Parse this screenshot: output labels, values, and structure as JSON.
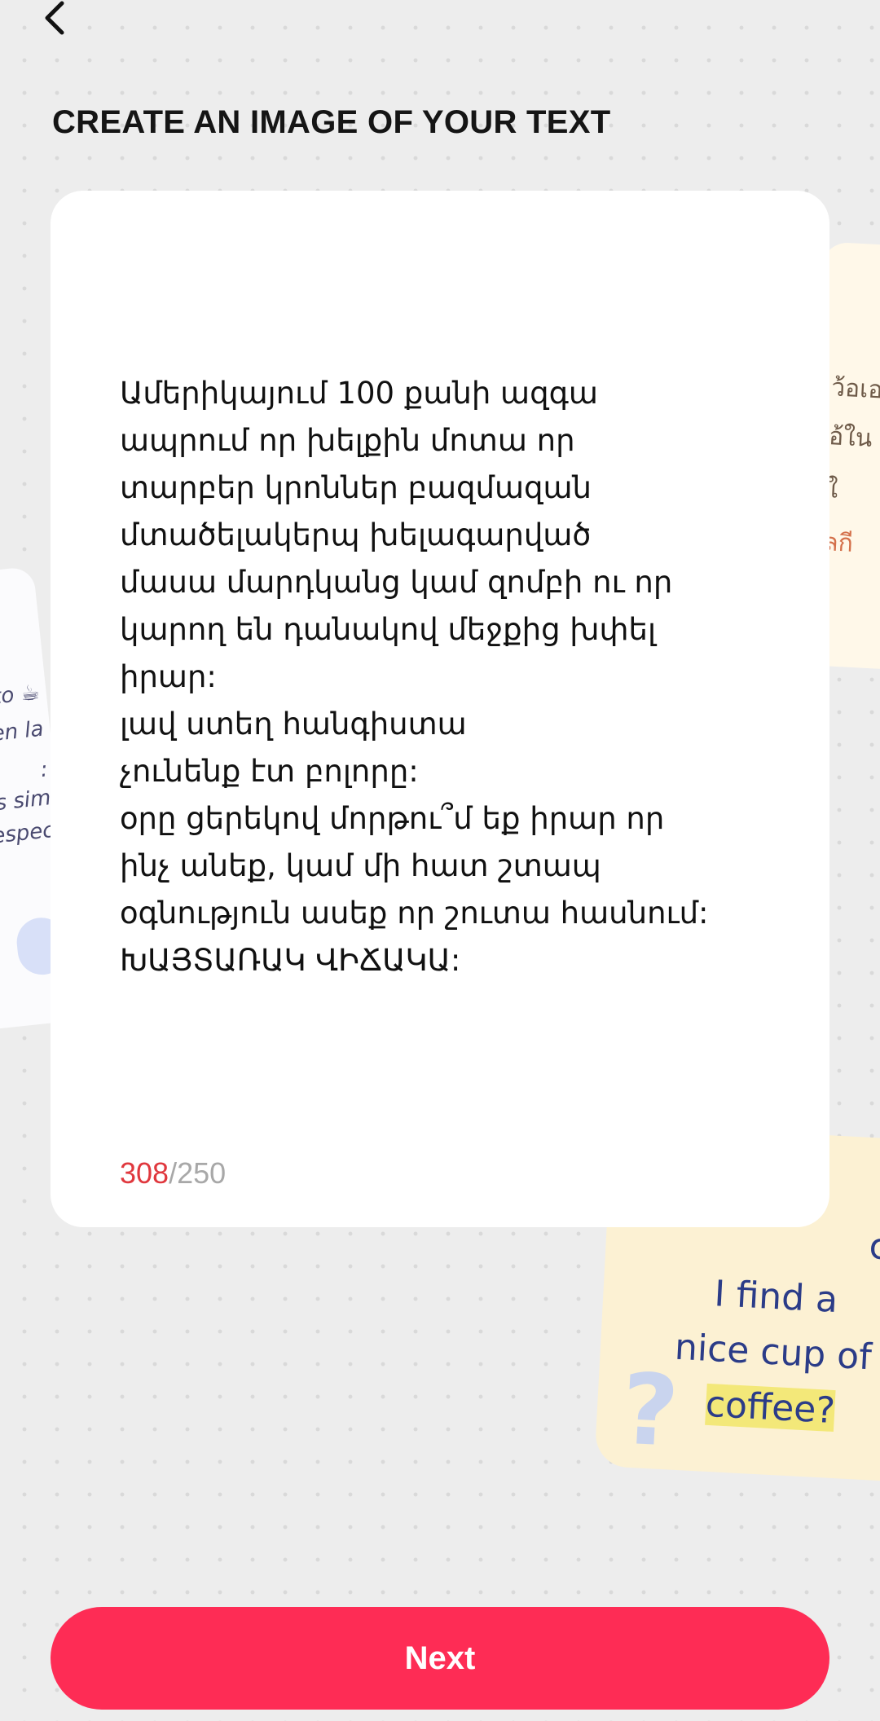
{
  "header": {
    "title": "CREATE AN IMAGE OF YOUR TEXT"
  },
  "background_cards": {
    "right": {
      "lines": [
        "ว้อเอ",
        "อ้ใน",
        "ใ",
        "ลกี"
      ]
    },
    "left": {
      "lines": [
        "ito ☕",
        "en la",
        ":",
        "ás sim",
        "espec"
      ]
    },
    "bottom": {
      "line1": "can",
      "line2": "I find a",
      "line3": "nice cup of",
      "line4": "coffee?"
    }
  },
  "editor": {
    "text": "Ամերիկայում 100 քանի ազգա\nապրում որ խելքին մոտա որ\nտարբեր կրոններ բազմազան\nմտածելակերպ խելագարված\nմասա մարդկանց կամ զոմբի ու որ\nկարող են դանակով մեջքից խփել\nիրար:\nլավ ստեղ հանգիստա\nչունենք էտ բոլորը:\nօրը ցերեկով մորթու՞մ եք իրար որ\nինչ անեք, կամ մի հատ շտապ\nօգնություն ասեք որ շուտա հասնում:\nԽԱՅՏԱՌԱԿ ՎԻՃԱԿԱ:",
    "char_count": "308",
    "separator": "/",
    "char_limit": "250"
  },
  "actions": {
    "next_label": "Next"
  },
  "colors": {
    "accent": "#fe2c55",
    "over_limit": "#e0383e",
    "background": "#ededed"
  },
  "icons": {
    "back": "chevron-left-icon"
  }
}
